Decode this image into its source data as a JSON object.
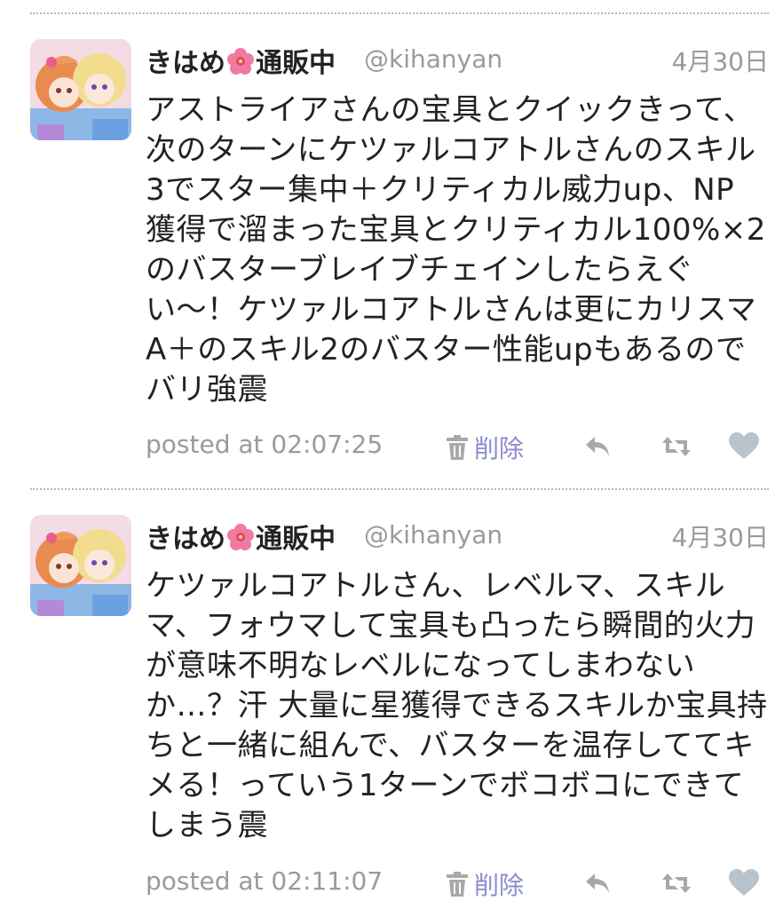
{
  "colors": {
    "text": "#222222",
    "muted": "#9a9a9a",
    "delete_link": "#8c8ccf",
    "icon": "#a8a8a8",
    "heart": "#b9c3cc",
    "divider": "#b8b8b8"
  },
  "tweets": [
    {
      "user": {
        "name_prefix": "きはめ",
        "name_emoji": "hibiscus-icon",
        "name_suffix": "通販中",
        "handle": "@kihanyan"
      },
      "date": "4月30日",
      "lines": [
        "アストライアさんの宝具とクイックきって、",
        "次のターンにケツァルコアトルさんのスキル",
        "3でスター集中＋クリティカル威力up、NP",
        "獲得で溜まった宝具とクリティカル100%×2",
        "のバスターブレイブチェインしたらえぐ",
        "い〜！ケツァルコアトルさんは更にカリスマ",
        "A＋のスキル2のバスター性能upもあるので",
        "バリ強震"
      ],
      "posted_at": "posted at 02:07:25",
      "delete_label": "削除"
    },
    {
      "user": {
        "name_prefix": "きはめ",
        "name_emoji": "hibiscus-icon",
        "name_suffix": "通販中",
        "handle": "@kihanyan"
      },
      "date": "4月30日",
      "lines": [
        "ケツァルコアトルさん、レベルマ、スキル",
        "マ、フォウマして宝具も凸ったら瞬間的火力",
        "が意味不明なレベルになってしまわない",
        "か…？汗 大量に星獲得できるスキルか宝具持",
        "ちと一緒に組んで、バスターを温存しててキ",
        "メる！っていう1ターンでボコボコにできて",
        "しまう震"
      ],
      "posted_at": "posted at 02:11:07",
      "delete_label": "削除"
    }
  ]
}
